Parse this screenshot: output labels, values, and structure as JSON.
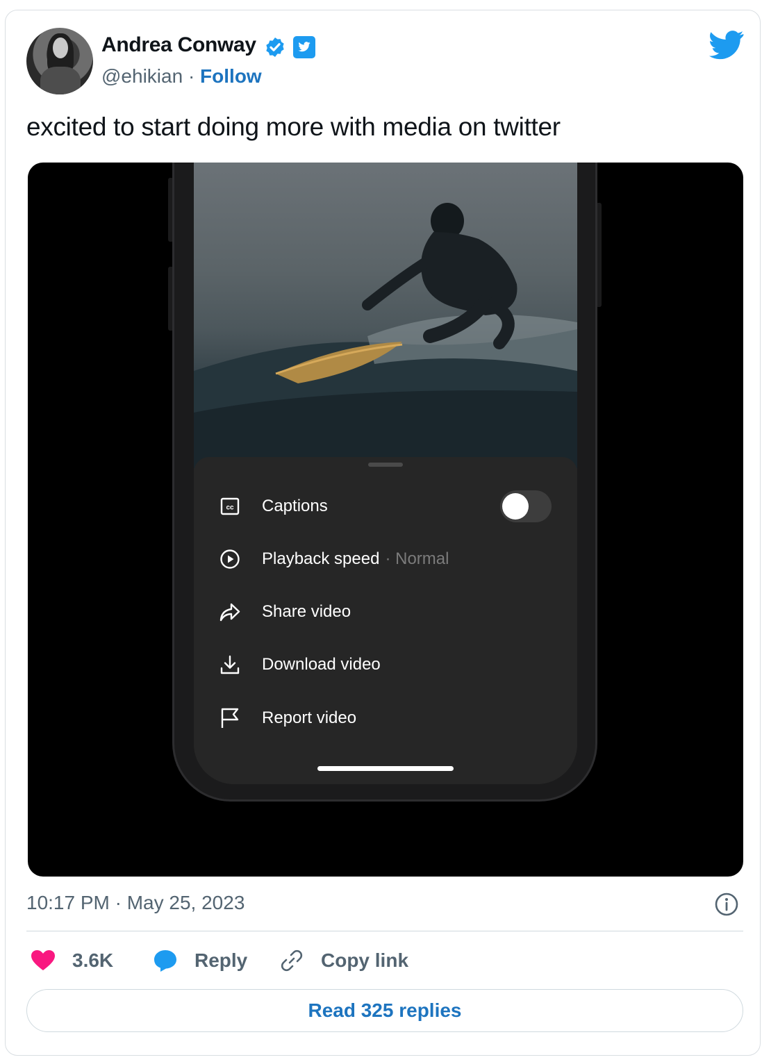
{
  "author": {
    "name": "Andrea Conway",
    "handle": "@ehikian",
    "separator": "·",
    "follow_label": "Follow"
  },
  "tweet": {
    "text": "excited to start doing more with media on twitter",
    "timestamp": "10:17 PM · May 25, 2023"
  },
  "media": {
    "menu": [
      {
        "label": "Captions",
        "icon": "cc-icon",
        "toggle": "off"
      },
      {
        "label": "Playback speed",
        "sub": "· Normal",
        "icon": "play-circle-icon"
      },
      {
        "label": "Share video",
        "icon": "share-icon"
      },
      {
        "label": "Download video",
        "icon": "download-icon"
      },
      {
        "label": "Report video",
        "icon": "flag-icon"
      }
    ]
  },
  "actions": {
    "likes": "3.6K",
    "reply_label": "Reply",
    "copy_label": "Copy link"
  },
  "read_replies_label": "Read 325 replies",
  "colors": {
    "accent": "#1d9bf0",
    "link": "#1d74bf",
    "like": "#f91880",
    "muted": "#536471"
  }
}
